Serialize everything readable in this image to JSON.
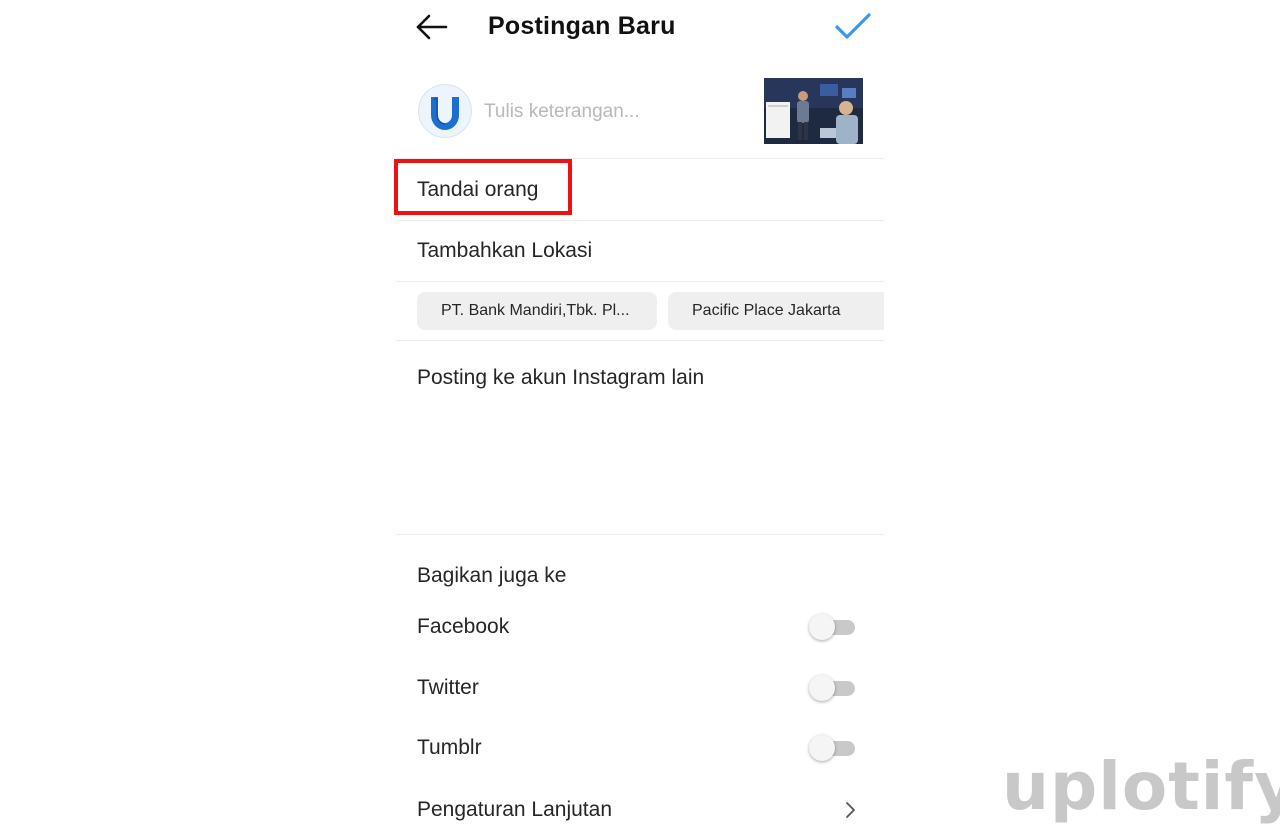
{
  "header": {
    "title": "Postingan Baru",
    "accent_color": "#3897f0"
  },
  "caption": {
    "placeholder": "Tulis keterangan...",
    "value": ""
  },
  "menu": {
    "tag_people": "Tandai orang",
    "add_location": "Tambahkan Lokasi",
    "post_other_account": "Posting ke akun Instagram lain",
    "advanced_settings": "Pengaturan Lanjutan"
  },
  "location_suggestions": [
    "PT. Bank Mandiri,Tbk. Pl...",
    "Pacific Place Jakarta"
  ],
  "share": {
    "section_label": "Bagikan juga ke",
    "items": [
      {
        "label": "Facebook",
        "enabled": false
      },
      {
        "label": "Twitter",
        "enabled": false
      },
      {
        "label": "Tumblr",
        "enabled": false
      }
    ]
  },
  "highlight_color": "#ee1111",
  "watermark": "uplotify"
}
